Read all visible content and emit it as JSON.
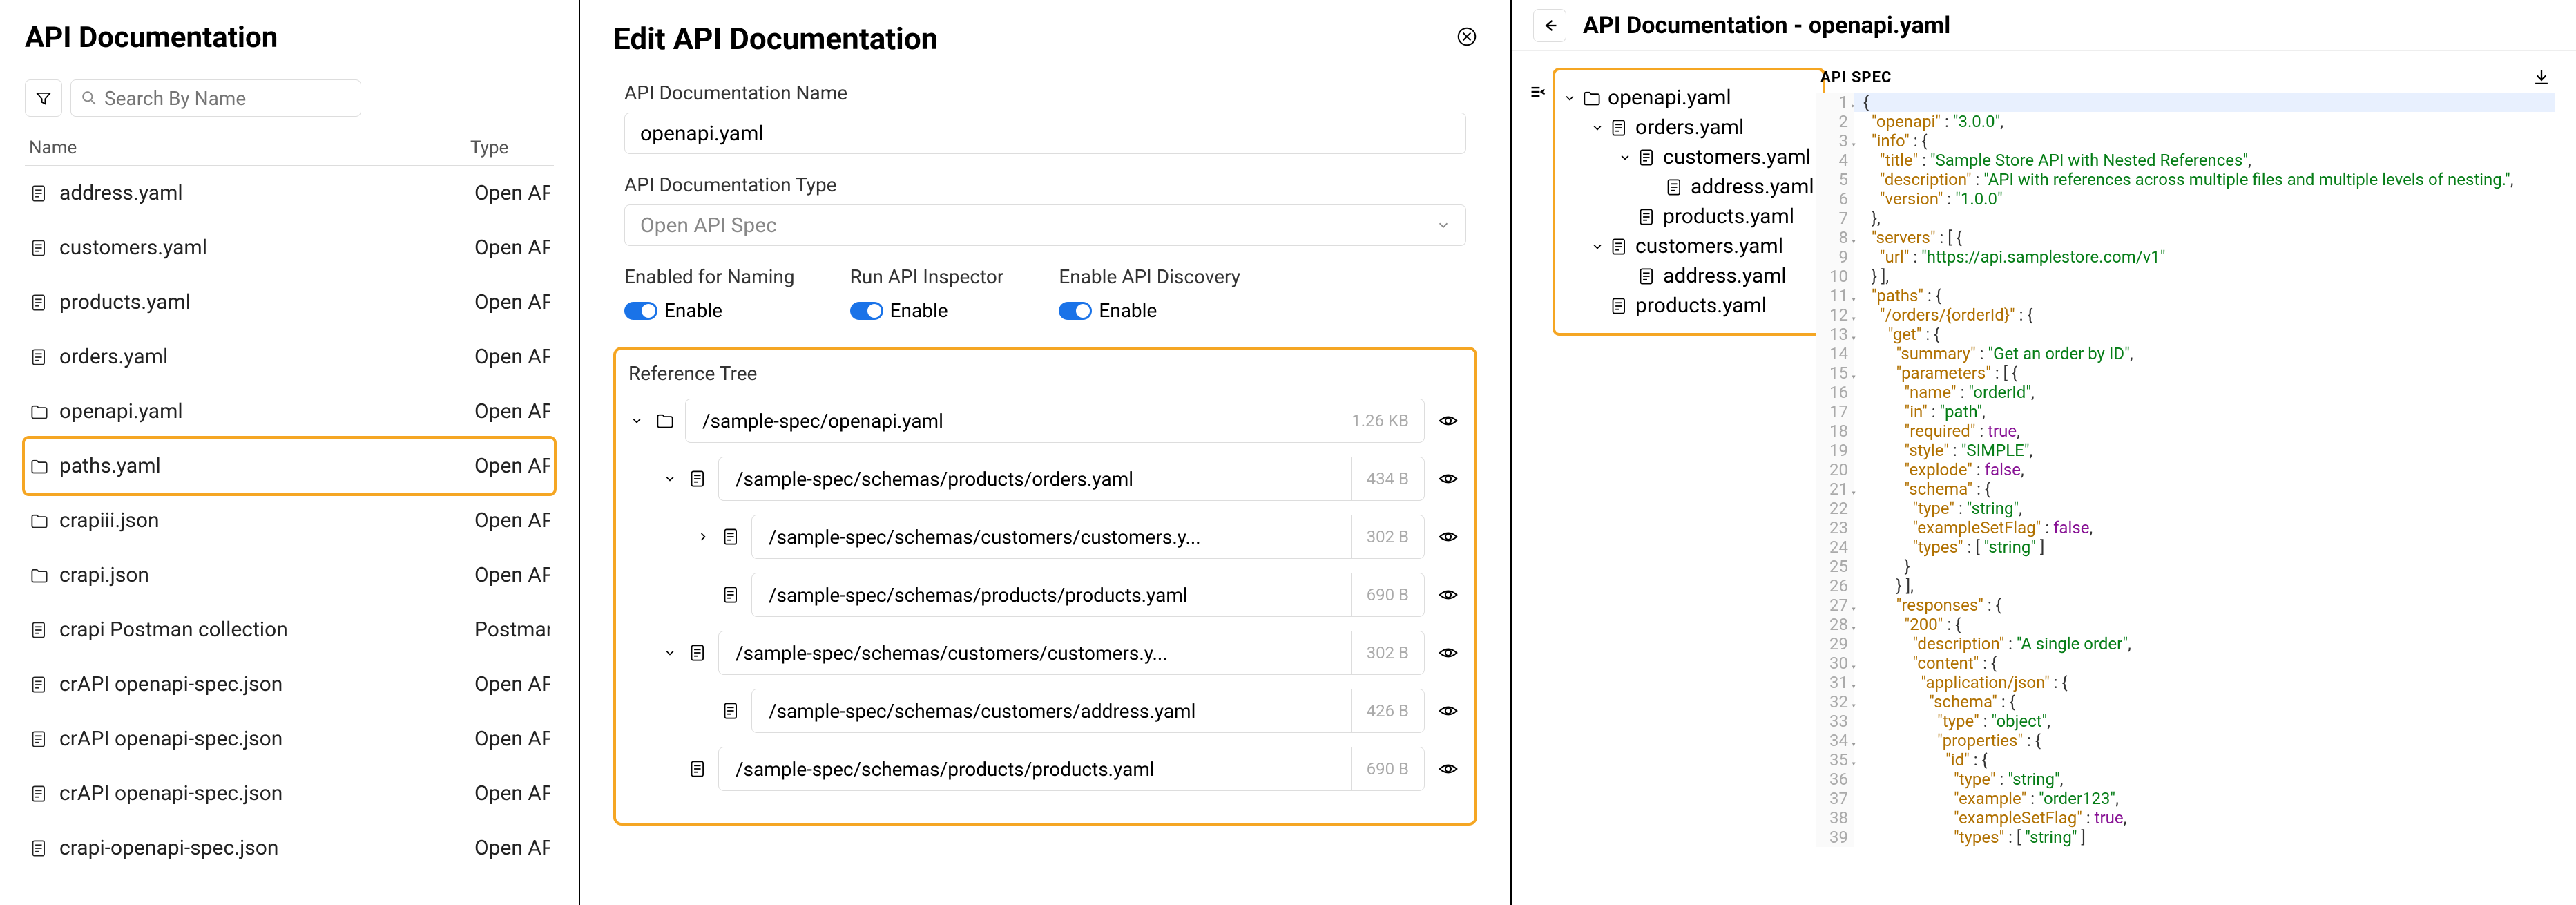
{
  "left": {
    "title": "API Documentation",
    "search_placeholder": "Search By Name",
    "columns": {
      "name": "Name",
      "type": "Type"
    },
    "files": [
      {
        "icon": "doc",
        "name": "address.yaml",
        "type": "Open API Spe"
      },
      {
        "icon": "doc",
        "name": "customers.yaml",
        "type": "Open API Spe"
      },
      {
        "icon": "doc",
        "name": "products.yaml",
        "type": "Open API Spe"
      },
      {
        "icon": "doc",
        "name": "orders.yaml",
        "type": "Open API Spe"
      },
      {
        "icon": "folder",
        "name": "openapi.yaml",
        "type": "Open API Spe"
      },
      {
        "icon": "folder",
        "name": "paths.yaml",
        "type": "Open API Spe",
        "highlight": true
      },
      {
        "icon": "folder",
        "name": "crapiii.json",
        "type": "Open API Spe"
      },
      {
        "icon": "folder",
        "name": "crapi.json",
        "type": "Open API Spe"
      },
      {
        "icon": "doc",
        "name": "crapi Postman collection",
        "type": "Postman Coll"
      },
      {
        "icon": "doc",
        "name": "crAPI openapi-spec.json",
        "type": "Open API Spe"
      },
      {
        "icon": "doc",
        "name": "crAPI openapi-spec.json",
        "type": "Open API Spe"
      },
      {
        "icon": "doc",
        "name": "crAPI openapi-spec.json",
        "type": "Open API Spe"
      },
      {
        "icon": "doc",
        "name": "crapi-openapi-spec.json",
        "type": "Open API Spe"
      }
    ]
  },
  "mid": {
    "title": "Edit API Documentation",
    "name_label": "API Documentation Name",
    "name_value": "openapi.yaml",
    "type_label": "API Documentation Type",
    "type_value": "Open API Spec",
    "toggles": [
      {
        "label": "Enabled for Naming",
        "text": "Enable",
        "on": true
      },
      {
        "label": "Run API Inspector",
        "text": "Enable",
        "on": true
      },
      {
        "label": "Enable API Discovery",
        "text": "Enable",
        "on": true
      }
    ],
    "ref_title": "Reference Tree",
    "refs": [
      {
        "indent": 0,
        "chev": "down",
        "icon": "folder",
        "path": "/sample-spec/openapi.yaml",
        "size": "1.26 KB"
      },
      {
        "indent": 1,
        "chev": "down",
        "icon": "doc",
        "path": "/sample-spec/schemas/products/orders.yaml",
        "size": "434 B"
      },
      {
        "indent": 2,
        "chev": "right",
        "icon": "doc",
        "path": "/sample-spec/schemas/customers/customers.y...",
        "size": "302 B"
      },
      {
        "indent": 2,
        "chev": "",
        "icon": "doc",
        "path": "/sample-spec/schemas/products/products.yaml",
        "size": "690 B"
      },
      {
        "indent": 1,
        "chev": "down",
        "icon": "doc",
        "path": "/sample-spec/schemas/customers/customers.y...",
        "size": "302 B"
      },
      {
        "indent": 2,
        "chev": "",
        "icon": "doc",
        "path": "/sample-spec/schemas/customers/address.yaml",
        "size": "426 B"
      },
      {
        "indent": 1,
        "chev": "",
        "icon": "doc",
        "path": "/sample-spec/schemas/products/products.yaml",
        "size": "690 B"
      }
    ]
  },
  "right": {
    "title": "API Documentation - openapi.yaml",
    "tree": [
      {
        "indent": 0,
        "chev": "down",
        "icon": "folder",
        "name": "openapi.yaml"
      },
      {
        "indent": 1,
        "chev": "down",
        "icon": "doc",
        "name": "orders.yaml"
      },
      {
        "indent": 2,
        "chev": "down",
        "icon": "doc",
        "name": "customers.yaml"
      },
      {
        "indent": 3,
        "chev": "",
        "icon": "doc",
        "name": "address.yaml"
      },
      {
        "indent": 2,
        "chev": "",
        "icon": "doc",
        "name": "products.yaml"
      },
      {
        "indent": 1,
        "chev": "down",
        "icon": "doc",
        "name": "customers.yaml"
      },
      {
        "indent": 2,
        "chev": "",
        "icon": "doc",
        "name": "address.yaml"
      },
      {
        "indent": 1,
        "chev": "",
        "icon": "doc",
        "name": "products.yaml"
      }
    ],
    "code": {
      "title": "API SPEC",
      "lines": [
        {
          "n": 1,
          "hl": true,
          "fold": true,
          "html": "<span class='p'>{</span>"
        },
        {
          "n": 2,
          "html": "  <span class='k'>\"openapi\"</span> <span class='p'>:</span> <span class='s'>\"3.0.0\"</span><span class='p'>,</span>"
        },
        {
          "n": 3,
          "fold": true,
          "html": "  <span class='k'>\"info\"</span> <span class='p'>: {</span>"
        },
        {
          "n": 4,
          "html": "    <span class='k'>\"title\"</span> <span class='p'>:</span> <span class='s'>\"Sample Store API with Nested References\"</span><span class='p'>,</span>"
        },
        {
          "n": 5,
          "html": "    <span class='k'>\"description\"</span> <span class='p'>:</span> <span class='s'>\"API with references across multiple files and multiple levels of nesting.\"</span><span class='p'>,</span>"
        },
        {
          "n": 6,
          "html": "    <span class='k'>\"version\"</span> <span class='p'>:</span> <span class='s'>\"1.0.0\"</span>"
        },
        {
          "n": 7,
          "html": "  <span class='p'>},</span>"
        },
        {
          "n": 8,
          "fold": true,
          "html": "  <span class='k'>\"servers\"</span> <span class='p'>: [ {</span>"
        },
        {
          "n": 9,
          "html": "    <span class='k'>\"url\"</span> <span class='p'>:</span> <span class='s'>\"https://api.samplestore.com/v1\"</span>"
        },
        {
          "n": 10,
          "html": "  <span class='p'>} ],</span>"
        },
        {
          "n": 11,
          "fold": true,
          "html": "  <span class='k'>\"paths\"</span> <span class='p'>: {</span>"
        },
        {
          "n": 12,
          "fold": true,
          "html": "    <span class='k'>\"/orders/{orderId}\"</span> <span class='p'>: {</span>"
        },
        {
          "n": 13,
          "fold": true,
          "html": "      <span class='k'>\"get\"</span> <span class='p'>: {</span>"
        },
        {
          "n": 14,
          "html": "        <span class='k'>\"summary\"</span> <span class='p'>:</span> <span class='s'>\"Get an order by ID\"</span><span class='p'>,</span>"
        },
        {
          "n": 15,
          "fold": true,
          "html": "        <span class='k'>\"parameters\"</span> <span class='p'>: [ {</span>"
        },
        {
          "n": 16,
          "html": "          <span class='k'>\"name\"</span> <span class='p'>:</span> <span class='s'>\"orderId\"</span><span class='p'>,</span>"
        },
        {
          "n": 17,
          "html": "          <span class='k'>\"in\"</span> <span class='p'>:</span> <span class='s'>\"path\"</span><span class='p'>,</span>"
        },
        {
          "n": 18,
          "html": "          <span class='k'>\"required\"</span> <span class='p'>:</span> <span class='b'>true</span><span class='p'>,</span>"
        },
        {
          "n": 19,
          "html": "          <span class='k'>\"style\"</span> <span class='p'>:</span> <span class='s'>\"SIMPLE\"</span><span class='p'>,</span>"
        },
        {
          "n": 20,
          "html": "          <span class='k'>\"explode\"</span> <span class='p'>:</span> <span class='b'>false</span><span class='p'>,</span>"
        },
        {
          "n": 21,
          "fold": true,
          "html": "          <span class='k'>\"schema\"</span> <span class='p'>: {</span>"
        },
        {
          "n": 22,
          "html": "            <span class='k'>\"type\"</span> <span class='p'>:</span> <span class='s'>\"string\"</span><span class='p'>,</span>"
        },
        {
          "n": 23,
          "html": "            <span class='k'>\"exampleSetFlag\"</span> <span class='p'>:</span> <span class='b'>false</span><span class='p'>,</span>"
        },
        {
          "n": 24,
          "html": "            <span class='k'>\"types\"</span> <span class='p'>: [</span> <span class='s'>\"string\"</span> <span class='p'>]</span>"
        },
        {
          "n": 25,
          "html": "          <span class='p'>}</span>"
        },
        {
          "n": 26,
          "html": "        <span class='p'>} ],</span>"
        },
        {
          "n": 27,
          "fold": true,
          "html": "        <span class='k'>\"responses\"</span> <span class='p'>: {</span>"
        },
        {
          "n": 28,
          "fold": true,
          "html": "          <span class='k'>\"200\"</span> <span class='p'>: {</span>"
        },
        {
          "n": 29,
          "html": "            <span class='k'>\"description\"</span> <span class='p'>:</span> <span class='s'>\"A single order\"</span><span class='p'>,</span>"
        },
        {
          "n": 30,
          "fold": true,
          "html": "            <span class='k'>\"content\"</span> <span class='p'>: {</span>"
        },
        {
          "n": 31,
          "fold": true,
          "html": "              <span class='k'>\"application/json\"</span> <span class='p'>: {</span>"
        },
        {
          "n": 32,
          "fold": true,
          "html": "                <span class='k'>\"schema\"</span> <span class='p'>: {</span>"
        },
        {
          "n": 33,
          "html": "                  <span class='k'>\"type\"</span> <span class='p'>:</span> <span class='s'>\"object\"</span><span class='p'>,</span>"
        },
        {
          "n": 34,
          "fold": true,
          "html": "                  <span class='k'>\"properties\"</span> <span class='p'>: {</span>"
        },
        {
          "n": 35,
          "fold": true,
          "html": "                    <span class='k'>\"id\"</span> <span class='p'>: {</span>"
        },
        {
          "n": 36,
          "html": "                      <span class='k'>\"type\"</span> <span class='p'>:</span> <span class='s'>\"string\"</span><span class='p'>,</span>"
        },
        {
          "n": 37,
          "html": "                      <span class='k'>\"example\"</span> <span class='p'>:</span> <span class='s'>\"order123\"</span><span class='p'>,</span>"
        },
        {
          "n": 38,
          "html": "                      <span class='k'>\"exampleSetFlag\"</span> <span class='p'>:</span> <span class='b'>true</span><span class='p'>,</span>"
        },
        {
          "n": 39,
          "html": "                      <span class='k'>\"types\"</span> <span class='p'>: [</span> <span class='s'>\"string\"</span> <span class='p'>]</span>"
        }
      ]
    }
  }
}
